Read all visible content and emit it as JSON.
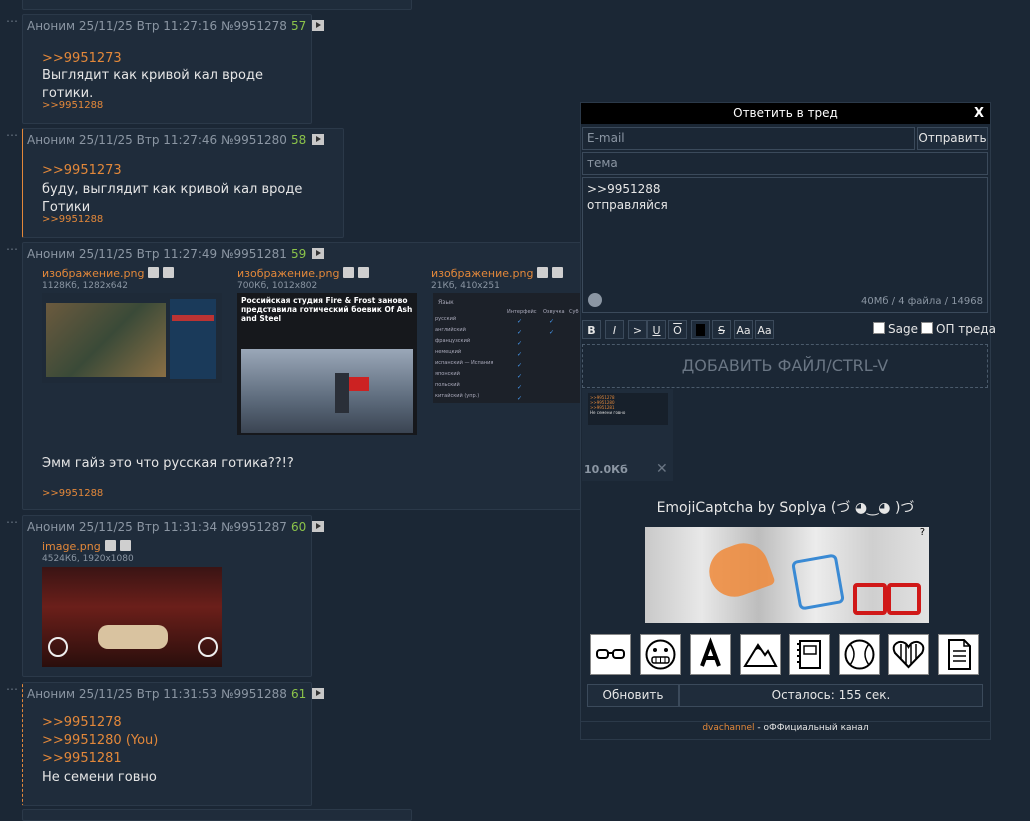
{
  "posts": [
    {
      "author": "Аноним",
      "date": "25/11/25 Втр 11:27:16",
      "id": "№9951278",
      "count": "57",
      "lines": [
        ">>9951273"
      ],
      "text": "Выглядит как кривой кал вроде готики.",
      "reply": ">>9951288"
    },
    {
      "author": "Аноним",
      "date": "25/11/25 Втр 11:27:46",
      "id": "№9951280",
      "count": "58",
      "lines": [
        ">>9951273"
      ],
      "text": "буду, выглядит как кривой кал вроде Готики",
      "reply": ">>9951288"
    },
    {
      "author": "Аноним",
      "date": "25/11/25 Втр 11:27:49",
      "id": "№9951281",
      "count": "59",
      "files": [
        {
          "name": "изображение.png",
          "meta": "1128Кб, 1282x642"
        },
        {
          "name": "изображение.png",
          "meta": "700Кб, 1012x802",
          "caption": "Российская студия Fire & Frost заново представила готический боевик Of Ash and Steel"
        },
        {
          "name": "изображение.png",
          "meta": "21Кб, 410x251",
          "table_header": "Язык",
          "cols": [
            "Интерфейс",
            "Озвучка",
            "Суб"
          ],
          "langs": [
            "русский",
            "английский",
            "французский",
            "немецкий",
            "испанский — Испания",
            "японский",
            "польский",
            "китайский (упр.)"
          ]
        }
      ],
      "text": "Эмм гайз это что русская готика??!?",
      "reply": ">>9951288"
    },
    {
      "author": "Аноним",
      "date": "25/11/25 Втр 11:31:34",
      "id": "№9951287",
      "count": "60",
      "files": [
        {
          "name": "image.png",
          "meta": "4524Кб, 1920x1080"
        }
      ]
    },
    {
      "author": "Аноним",
      "date": "25/11/25 Втр 11:31:53",
      "id": "№9951288",
      "count": "61",
      "lines": [
        ">>9951278",
        ">>9951280 (You)",
        ">>9951281"
      ],
      "text": "Не семени говно"
    }
  ],
  "reply_form": {
    "title": "Ответить в тред",
    "close": "X",
    "email_placeholder": "E-mail",
    "send": "Отправить",
    "subject_placeholder": "тема",
    "message_line1": ">>9951288",
    "message_line2": "отправляйся",
    "limits": "40Мб / 4 файла / 14968",
    "format_buttons": [
      "B",
      "I",
      ">",
      "U",
      "O",
      "",
      "S",
      "Aa",
      "Aa"
    ],
    "sage": "Sage",
    "op": "ОП треда",
    "add_file": "ДОБАВИТЬ ФАЙЛ/CTRL-V",
    "attached_size": "10.0Кб",
    "attached_lines": [
      ">>9951278",
      ">>9951280",
      ">>9951281",
      "Не семени говно"
    ],
    "captcha_title": "EmojiCaptcha by Soplya (づ ◕‿◕ )づ",
    "captcha_help": "?",
    "emoji_options": [
      "glasses-icon",
      "grimace-face-icon",
      "letter-a-icon",
      "mountain-icon",
      "notebook-icon",
      "baseball-icon",
      "heart-icon",
      "document-icon"
    ],
    "refresh": "Обновить",
    "remaining": "Осталось: 155 сек.",
    "footer_link": "dvachannel",
    "footer_text": " - оФФициальный канал"
  },
  "colors": {
    "background": "#1b2735",
    "post": "#1f2c3b",
    "link": "#e3883a",
    "count": "#8bc34a"
  }
}
